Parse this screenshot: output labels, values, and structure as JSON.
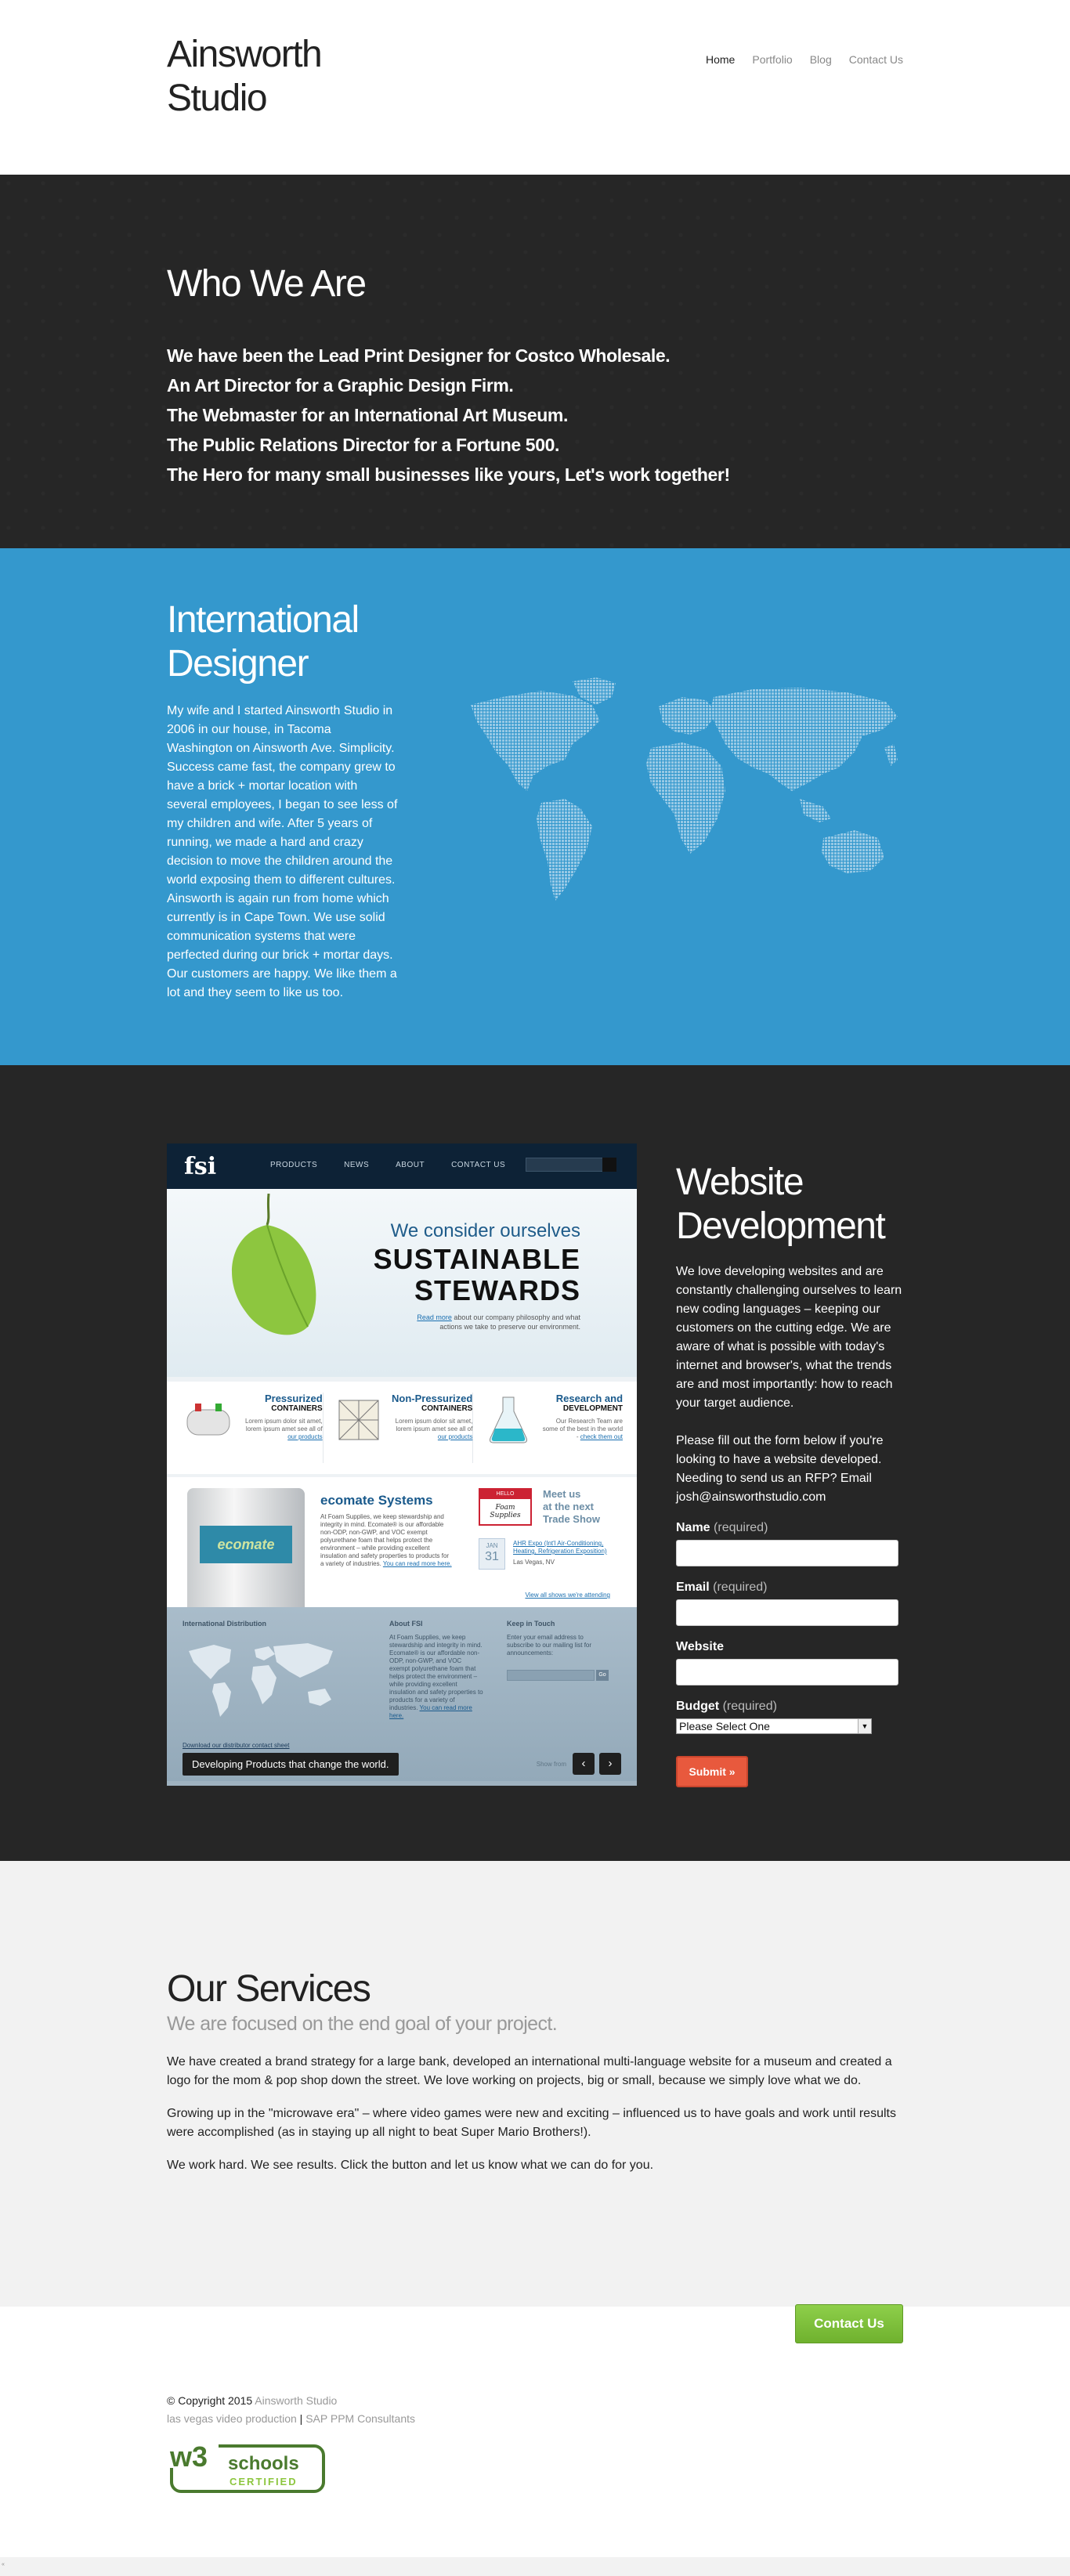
{
  "header": {
    "logo_line1": "Ainsworth",
    "logo_line2": "Studio",
    "nav": [
      "Home",
      "Portfolio",
      "Blog",
      "Contact Us"
    ]
  },
  "who": {
    "title": "Who We Are",
    "lines": [
      "We have been the Lead Print Designer for Costco Wholesale.",
      "An Art Director for a Graphic Design Firm.",
      "The Webmaster for an International Art Museum.",
      "The Public Relations Director for a Fortune 500.",
      "The Hero for many small businesses like yours, Let's work together!"
    ]
  },
  "intl": {
    "title": "International Designer",
    "body": "My wife and I started Ainsworth Studio in 2006 in our house, in Tacoma Washington on Ainsworth Ave. Simplicity. Success came fast, the company grew to have a brick + mortar location with several employees, I began to see less of my children and wife. After 5 years of running, we made a hard and crazy decision to move the children around the world exposing them to different cultures. Ainsworth is again run from home which currently is in Cape Town. We use solid communication systems that were perfected during our brick + mortar days. Our customers are happy. We like them a lot and they seem to like us too."
  },
  "mockup": {
    "logo": "fsi",
    "nav": [
      "PRODUCTS",
      "NEWS",
      "ABOUT",
      "CONTACT US"
    ],
    "hero_line1": "We consider ourselves",
    "hero_line2": "SUSTAINABLE",
    "hero_line3": "STEWARDS",
    "hero_desc_link": "Read more",
    "hero_desc": "about our company philosophy and what actions we take to preserve our environment.",
    "products": [
      {
        "title": "Pressurized",
        "subtitle": "CONTAINERS",
        "desc": "Lorem ipsum dolor sit amet, lorem ipsum amet see all of",
        "link": "our products"
      },
      {
        "title": "Non-Pressurized",
        "subtitle": "CONTAINERS",
        "desc": "Lorem ipsum dolor sit amet, lorem ipsum amet see all of",
        "link": "our products"
      },
      {
        "title": "Research and",
        "subtitle": "DEVELOPMENT",
        "desc": "Our Research Team are some of the best in the world -",
        "link": "check them out"
      }
    ],
    "drum_label": "ecomate",
    "eco_title": "ecomate Systems",
    "eco_desc": "At Foam Supplies, we keep stewardship and integrity in mind. Ecomate® is our affordable non-ODP, non-GWP, and VOC exempt polyurethane foam that helps protect the environment – while providing excellent insulation and safety properties to products for a variety of industries.",
    "eco_link": "You can read more here.",
    "badge_top": "HELLO",
    "badge_name": "Foam Supplies",
    "meet_line1": "Meet us",
    "meet_line2": "at the next",
    "meet_line3": "Trade Show",
    "cal_month": "JAN",
    "cal_day": "31",
    "event_link": "AHR Expo (Int'l Air-Conditioning, Heating, Refrigeration Exposition)",
    "event_place": "Las Vegas, NV",
    "view_all": "View all shows we're attending",
    "foot_h1": "International Distribution",
    "foot_h2": "About FSI",
    "foot_h3": "Keep in Touch",
    "foot_about": "At Foam Supplies, we keep stewardship and integrity in mind. Ecomate® is our affordable non-ODP, non-GWP, and VOC exempt polyurethane foam that helps protect the environment – while providing excellent insulation and safety properties to products for a variety of industries.",
    "foot_about_link": "You can read more here.",
    "foot_touch": "Enter your email address to subscribe to our mailing list for announcements:",
    "foot_go": "Go",
    "foot_pdf": "Download our distributor contact sheet",
    "caption": "Developing Products that change the world.",
    "arrows_label": "Show from",
    "arrow_prev": "‹",
    "arrow_next": "›"
  },
  "webdev": {
    "title": "Website Development",
    "p1": "We love developing websites and are constantly challenging ourselves to learn new coding languages – keeping our customers on the cutting edge. We are aware of what is possible with today's internet and browser's, what the trends are and most importantly: how to reach your target audience.",
    "p2": "Please fill out the form below if you're looking to have a website developed. Needing to send us an RFP? Email josh@ainsworthstudio.com",
    "form": {
      "name_label": "Name",
      "email_label": "Email",
      "website_label": "Website",
      "budget_label": "Budget",
      "required": "(required)",
      "budget_value": "Please Select One",
      "submit": "Submit »"
    }
  },
  "services": {
    "title": "Our Services",
    "subtitle": "We are focused on the end goal of your project.",
    "p1": "We have created a brand strategy for a large bank, developed an international multi-language website for a museum and created a logo for the mom & pop shop down the street. We love working on projects, big or small, because we simply love what we do.",
    "p2": "Growing up in the \"microwave era\" – where video games were new and exciting – influenced us to have goals and work until results were accomplished (as in staying up all night to beat Super Mario Brothers!).",
    "p3": "We work hard. We see results. Click the button and let us know what we can do for you.",
    "cta": "Contact Us"
  },
  "footer": {
    "copyright": "© Copyright 2015",
    "brand": "Ainsworth Studio",
    "link1": "las vegas video production",
    "sep": "|",
    "link2": "SAP PPM Consultants",
    "badge_w3": "w3",
    "badge_schools": "schools",
    "badge_certified": "CERTIFIED"
  },
  "bottom": {
    "text": "«"
  },
  "colors": {
    "dark": "#262626",
    "blue": "#3498cd",
    "orange": "#e8593d",
    "green": "#78bb36",
    "w3_green": "#4a7a2e"
  }
}
